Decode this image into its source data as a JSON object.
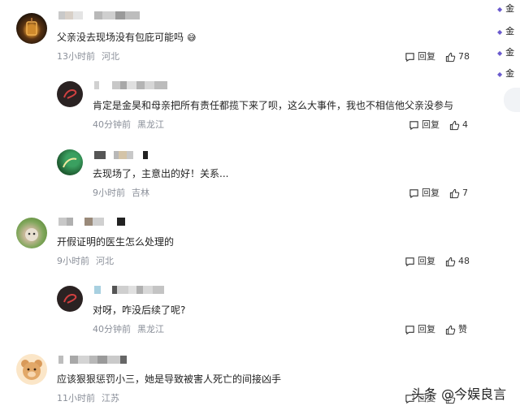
{
  "comments": [
    {
      "text": "父亲没去现场没有包庇可能吗",
      "emoji": "😅",
      "time": "13小时前",
      "location": "河北",
      "reply_label": "回复",
      "likes": "78"
    },
    {
      "text": "肯定是金昊和母亲把所有责任都揽下来了呗，这么大事件，我也不相信他父亲没参与",
      "time": "40分钟前",
      "location": "黑龙江",
      "reply_label": "回复",
      "likes": "4"
    },
    {
      "text": "去现场了，主意出的好！关系...",
      "time": "9小时前",
      "location": "吉林",
      "reply_label": "回复",
      "likes": "7"
    },
    {
      "text": "开假证明的医生怎么处理的",
      "time": "9小时前",
      "location": "河北",
      "reply_label": "回复",
      "likes": "48"
    },
    {
      "text": "对呀，咋没后续了呢?",
      "time": "40分钟前",
      "location": "黑龙江",
      "reply_label": "回复",
      "likes": "赞"
    },
    {
      "text": "应该狠狠惩罚小三，她是导致被害人死亡的间接凶手",
      "time": "11小时前",
      "location": "江苏",
      "reply_label": "回复",
      "likes": ""
    }
  ],
  "sidebar": {
    "items": [
      "金",
      "金",
      "金",
      "金"
    ]
  },
  "watermark": "头条 @今娱良言",
  "colors": {
    "meta_gray": "#8a8f99",
    "sidebar_dot": "#6a5acd"
  }
}
